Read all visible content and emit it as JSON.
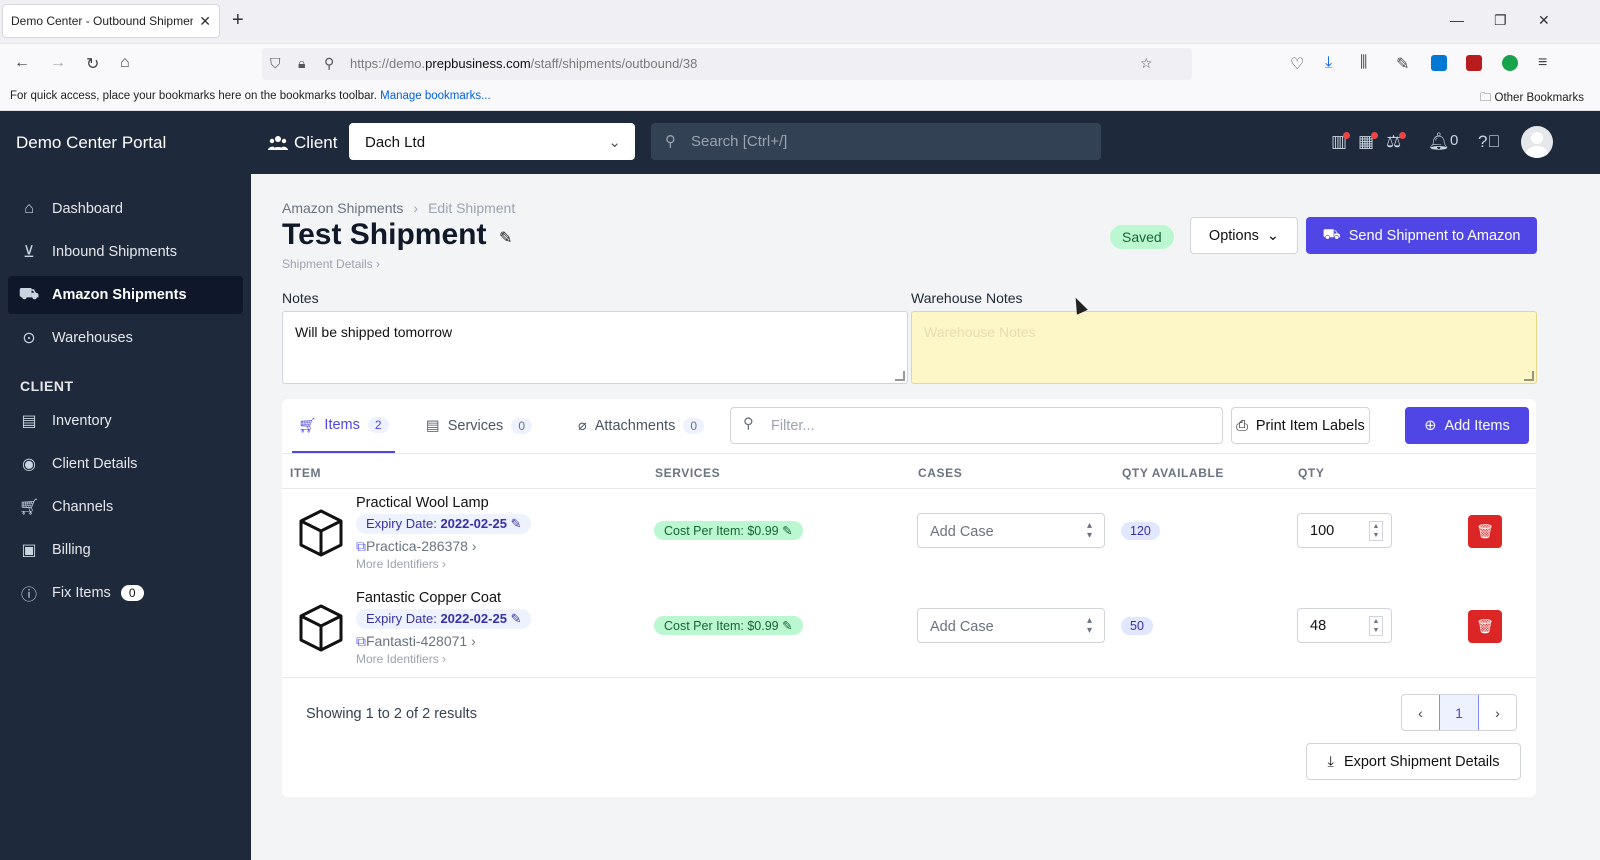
{
  "browser": {
    "tab_title": "Demo Center - Outbound Shipment",
    "tab_close": "✕",
    "new_tab": "+",
    "url_dim_prefix": "https://demo.",
    "url_domain": "prepbusiness.com",
    "url_path": "/staff/shipments/outbound/38",
    "bookmarks_msg": "For quick access, place your bookmarks here on the bookmarks toolbar.",
    "bookmarks_link": "Manage bookmarks...",
    "other_bookmarks": "Other Bookmarks"
  },
  "header": {
    "brand": "Demo Center Portal",
    "client_label": "Client",
    "client_value": "Dach Ltd",
    "search_placeholder": "Search [Ctrl+/]",
    "notifications_count": "0"
  },
  "sidebar": {
    "items": [
      {
        "label": "Dashboard",
        "icon": "home-icon"
      },
      {
        "label": "Inbound Shipments",
        "icon": "inbox-icon"
      },
      {
        "label": "Amazon Shipments",
        "icon": "truck-icon"
      },
      {
        "label": "Warehouses",
        "icon": "location-icon"
      }
    ],
    "section": "CLIENT",
    "client_items": [
      {
        "label": "Inventory",
        "icon": "warehouse-icon"
      },
      {
        "label": "Client Details",
        "icon": "user-circle-icon"
      },
      {
        "label": "Channels",
        "icon": "cart-icon"
      },
      {
        "label": "Billing",
        "icon": "money-icon"
      },
      {
        "label": "Fix Items",
        "icon": "alert-icon",
        "badge": "0"
      }
    ]
  },
  "page": {
    "breadcrumb_parent": "Amazon Shipments",
    "breadcrumb_current": "Edit Shipment",
    "title": "Test Shipment",
    "subtitle": "Shipment Details",
    "status": "Saved",
    "options_label": "Options",
    "send_label": "Send Shipment to Amazon",
    "notes_label": "Notes",
    "notes_value": "Will be shipped tomorrow",
    "warehouse_notes_label": "Warehouse Notes",
    "warehouse_notes_placeholder": "Warehouse Notes"
  },
  "tabs": [
    {
      "label": "Items",
      "count": "2"
    },
    {
      "label": "Services",
      "count": "0"
    },
    {
      "label": "Attachments",
      "count": "0"
    }
  ],
  "toolbar": {
    "filter_placeholder": "Filter...",
    "print_label": "Print Item Labels",
    "add_label": "Add Items"
  },
  "table": {
    "columns": [
      "ITEM",
      "SERVICES",
      "CASES",
      "QTY AVAILABLE",
      "QTY"
    ],
    "rows": [
      {
        "name": "Practical Wool Lamp",
        "expiry_label": "Expiry Date:",
        "expiry": "2022-02-25",
        "identifier": "Practica-286378",
        "more": "More Identifiers",
        "service": "Cost Per Item: $0.99",
        "case_placeholder": "Add Case",
        "qty_available": "120",
        "qty": "100"
      },
      {
        "name": "Fantastic Copper Coat",
        "expiry_label": "Expiry Date:",
        "expiry": "2022-02-25",
        "identifier": "Fantasti-428071",
        "more": "More Identifiers",
        "service": "Cost Per Item: $0.99",
        "case_placeholder": "Add Case",
        "qty_available": "50",
        "qty": "48"
      }
    ]
  },
  "footer": {
    "showing_prefix": "Showing ",
    "from": "1",
    "to_word": " to ",
    "to": "2",
    "of_word": " of ",
    "total": "2",
    "results_word": " results",
    "page": "1",
    "export_label": "Export Shipment Details"
  },
  "colors": {
    "primary": "#4f46e5",
    "sidebar": "#1e293b",
    "danger": "#dc2626",
    "success_bg": "#bbf7d0"
  }
}
